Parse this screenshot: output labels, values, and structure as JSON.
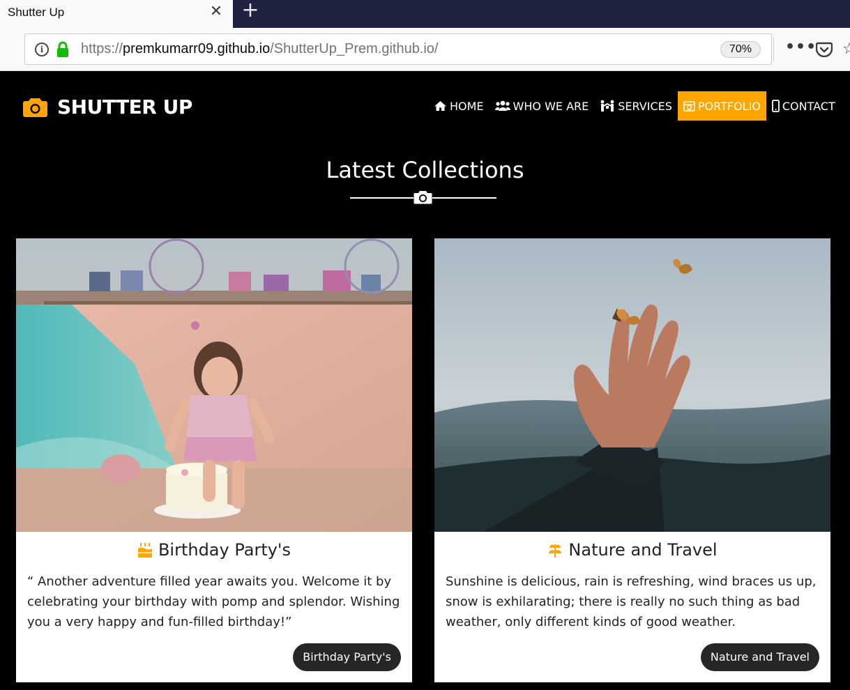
{
  "browser": {
    "tab_title": "Shutter Up",
    "url_prefix": "https://",
    "url_host": "premkumarr09.github.io",
    "url_path": "/ShutterUp_Prem.github.io/",
    "zoom": "70%"
  },
  "site": {
    "brand": "SHUTTER UP",
    "accent_color": "#ffa500",
    "menu": [
      {
        "label": "HOME",
        "icon": "home-icon"
      },
      {
        "label": "WHO WE ARE",
        "icon": "users-icon"
      },
      {
        "label": "SERVICES",
        "icon": "services-icon"
      },
      {
        "label": "PORTFOLIO",
        "icon": "camera-retro-icon",
        "active": true
      },
      {
        "label": "CONTACT",
        "icon": "mobile-icon"
      }
    ],
    "section_title": "Latest Collections",
    "cards": [
      {
        "title": "Birthday Party's",
        "icon": "birthday-cake-icon",
        "text": "“ Another adventure filled year awaits you. Welcome it by celebrating your birthday with pomp and splendor. Wishing you a very happy and fun-filled birthday!”",
        "tag": "Birthday Party's"
      },
      {
        "title": "Nature and Travel",
        "icon": "leaf-icon",
        "text": "Sunshine is delicious, rain is refreshing, wind braces us up, snow is exhilarating; there is really no such thing as bad weather, only different kinds of good weather.",
        "tag": "Nature and Travel"
      }
    ]
  }
}
